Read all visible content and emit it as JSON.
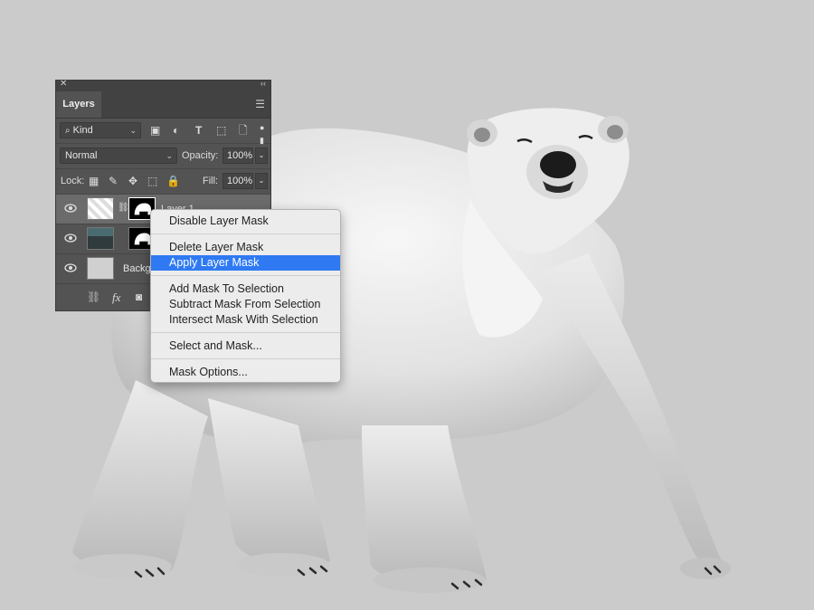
{
  "panel": {
    "close_icon": "close-icon",
    "collapse_icon": "double-chevron-icon",
    "tab": "Layers",
    "menu_icon": "hamburger-menu-icon",
    "filter": {
      "search_icon": "search-icon",
      "kind": "Kind",
      "filter_icons": [
        "image-filter-icon",
        "adjustment-filter-icon",
        "type-filter-icon",
        "shape-filter-icon",
        "smart-object-filter-icon",
        "filter-toggle-icon"
      ]
    },
    "blend_mode": "Normal",
    "opacity_label": "Opacity:",
    "opacity_value": "100%",
    "lock_label": "Lock:",
    "fill_label": "Fill:",
    "fill_value": "100%",
    "layers": [
      {
        "name": "Layer 1",
        "visible": true,
        "selected": true,
        "has_mask": true
      },
      {
        "name": "",
        "visible": true,
        "selected": false,
        "has_mask": true
      },
      {
        "name": "Backg",
        "visible": true,
        "selected": false,
        "has_mask": false
      }
    ],
    "footer": {
      "fx": "fx"
    }
  },
  "context_menu": {
    "items": [
      {
        "label": "Disable Layer Mask",
        "highlighted": false
      },
      {
        "label": "Delete Layer Mask",
        "highlighted": false
      },
      {
        "label": "Apply Layer Mask",
        "highlighted": true
      },
      {
        "label": "Add Mask To Selection",
        "highlighted": false
      },
      {
        "label": "Subtract Mask From Selection",
        "highlighted": false
      },
      {
        "label": "Intersect Mask With Selection",
        "highlighted": false
      },
      {
        "label": "Select and Mask...",
        "highlighted": false
      },
      {
        "label": "Mask Options...",
        "highlighted": false
      }
    ]
  },
  "colors": {
    "canvas_bg": "#cbcbcb",
    "panel_bg": "#535353",
    "menu_bg": "#ececec",
    "highlight": "#2f7af3"
  }
}
